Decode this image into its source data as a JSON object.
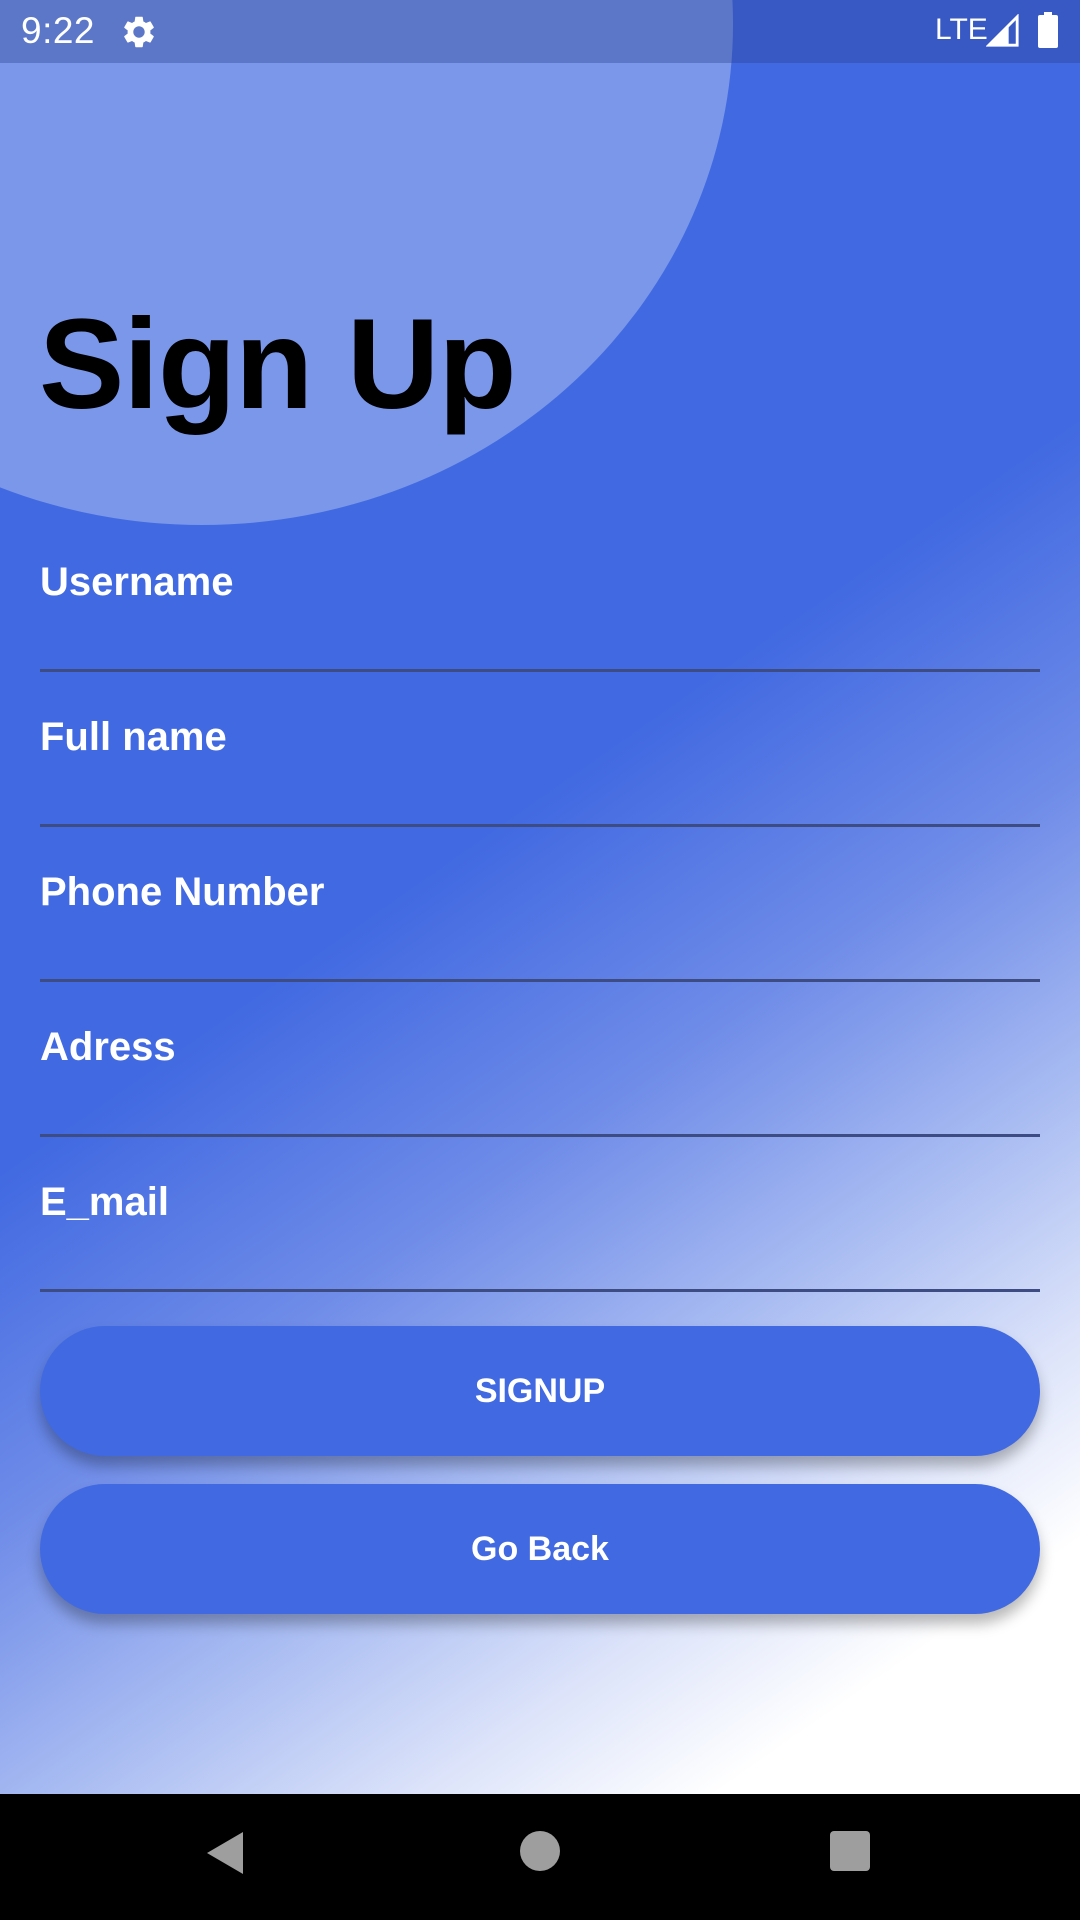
{
  "status_bar": {
    "time": "9:22",
    "network": "LTE",
    "icons": [
      "settings-gear-icon",
      "signal-icon",
      "battery-icon"
    ]
  },
  "page": {
    "title": "Sign Up"
  },
  "form": {
    "fields": [
      {
        "label": "Username",
        "value": ""
      },
      {
        "label": "Full name",
        "value": ""
      },
      {
        "label": "Phone Number",
        "value": ""
      },
      {
        "label": "Adress",
        "value": ""
      },
      {
        "label": "E_mail",
        "value": ""
      }
    ]
  },
  "buttons": {
    "signup_label": "SIGNUP",
    "go_back_label": "Go Back"
  },
  "nav_bar": {
    "icons": [
      "back-icon",
      "home-icon",
      "recent-apps-icon"
    ]
  },
  "colors": {
    "accent": "#4169e1",
    "circle": "#7a97e9",
    "underline": "#3d4d83",
    "text_light": "#ffffff",
    "title": "#000000"
  }
}
